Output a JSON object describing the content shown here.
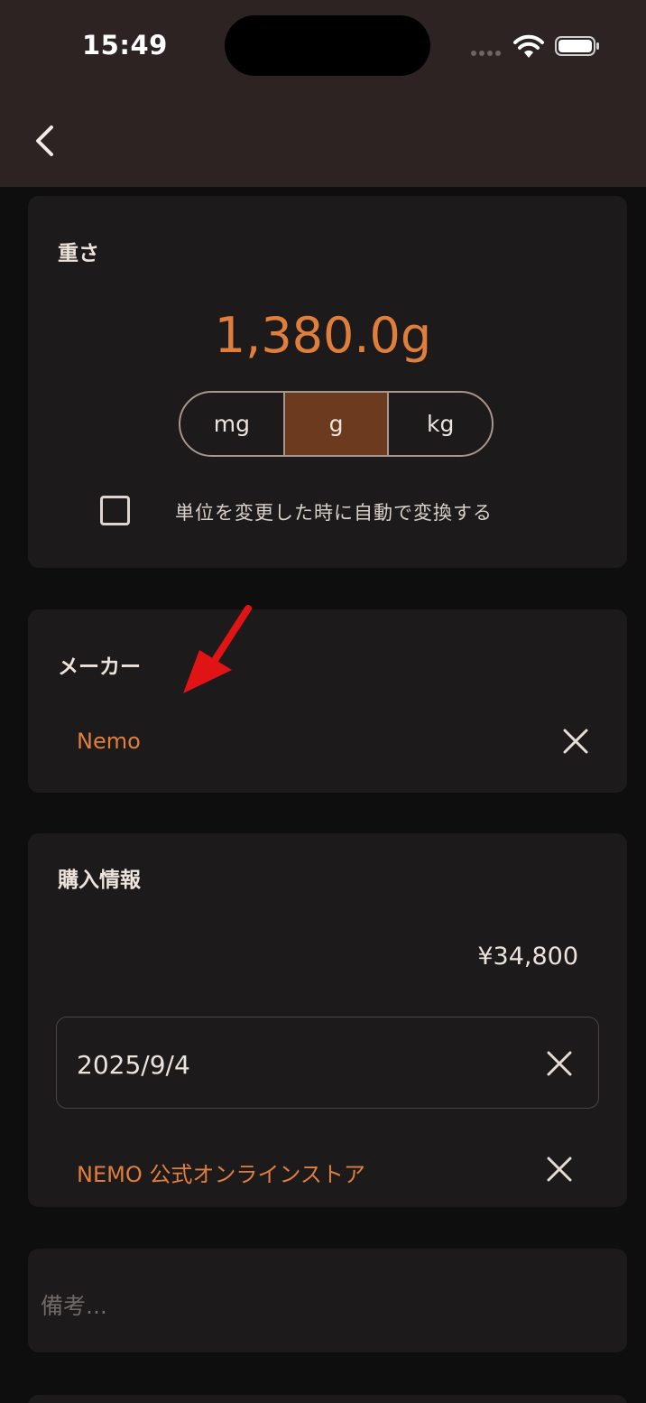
{
  "status_bar": {
    "time": "15:49"
  },
  "nav": {
    "back_icon": "chevron-left-icon"
  },
  "weight": {
    "title": "重さ",
    "value": "1,380.0g",
    "units": [
      "mg",
      "g",
      "kg"
    ],
    "selected_unit": "g",
    "auto_convert_label": "単位を変更した時に自動で変換する",
    "auto_convert_checked": false
  },
  "maker": {
    "title": "メーカー",
    "value": "Nemo"
  },
  "purchase": {
    "title": "購入情報",
    "price": "¥34,800",
    "date": "2025/9/4",
    "store": "NEMO 公式オンラインストア"
  },
  "notes": {
    "placeholder": "備考..."
  },
  "colors": {
    "accent": "#e07f3c",
    "selected_segment": "#6c3a1f",
    "card": "#1c1a1a",
    "header": "#2c2322",
    "annotation_arrow": "#e01414"
  }
}
